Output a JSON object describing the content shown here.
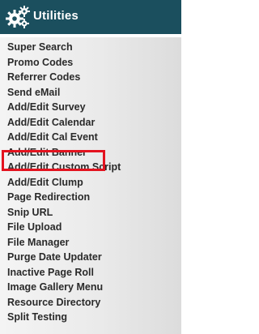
{
  "header": {
    "title": "Utilities",
    "icon": "gears-icon",
    "background_color": "#1b4f5e"
  },
  "menu": {
    "items": [
      {
        "label": "Super Search"
      },
      {
        "label": "Promo Codes"
      },
      {
        "label": "Referrer Codes"
      },
      {
        "label": "Send eMail"
      },
      {
        "label": "Add/Edit Survey"
      },
      {
        "label": "Add/Edit Calendar",
        "highlighted": true
      },
      {
        "label": "Add/Edit Cal Event"
      },
      {
        "label": "Add/Edit Banner"
      },
      {
        "label": "Add/Edit Custom Script"
      },
      {
        "label": "Add/Edit Clump"
      },
      {
        "label": "Page Redirection"
      },
      {
        "label": "Snip URL"
      },
      {
        "label": "File Upload"
      },
      {
        "label": "File Manager"
      },
      {
        "label": "Purge Date Updater"
      },
      {
        "label": "Inactive Page Roll"
      },
      {
        "label": "Image Gallery Menu"
      },
      {
        "label": "Resource Directory"
      },
      {
        "label": "Split Testing"
      }
    ],
    "highlight_color": "#e3131f"
  }
}
